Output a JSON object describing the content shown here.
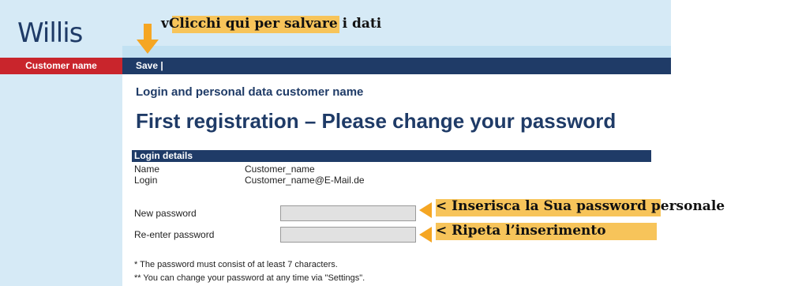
{
  "header": {
    "logo_text": "Willis",
    "save_label": "Save |"
  },
  "sidebar": {
    "items": [
      {
        "label": "Customer name"
      }
    ]
  },
  "main": {
    "subtitle": "Login and personal data customer name",
    "title": "First registration – Please change your password",
    "login_details": {
      "header": "Login details",
      "rows": [
        {
          "label": "Name",
          "value": "Customer_name"
        },
        {
          "label": "Login",
          "value": "Customer_name@E-Mail.de"
        }
      ]
    },
    "fields": [
      {
        "label": "New password",
        "value": ""
      },
      {
        "label": "Re-enter password",
        "value": ""
      }
    ],
    "notes": [
      "* The password must consist of at least 7 characters.",
      "** You can change your password at any time via \"Settings\"."
    ]
  },
  "annotations": {
    "save_hint_marker": "v",
    "save_hint_highlight": "Clicchi qui per salvare",
    "save_hint_rest": " i dati",
    "password_hint": "< Inserisca la Sua password personale",
    "repeat_hint": "< Ripeta l’inserimento"
  },
  "colors": {
    "navy": "#1f3b67",
    "sidebar_blue": "#d6eaf6",
    "red": "#c9252c",
    "highlight": "#f7c45a",
    "arrow": "#f5a623"
  }
}
